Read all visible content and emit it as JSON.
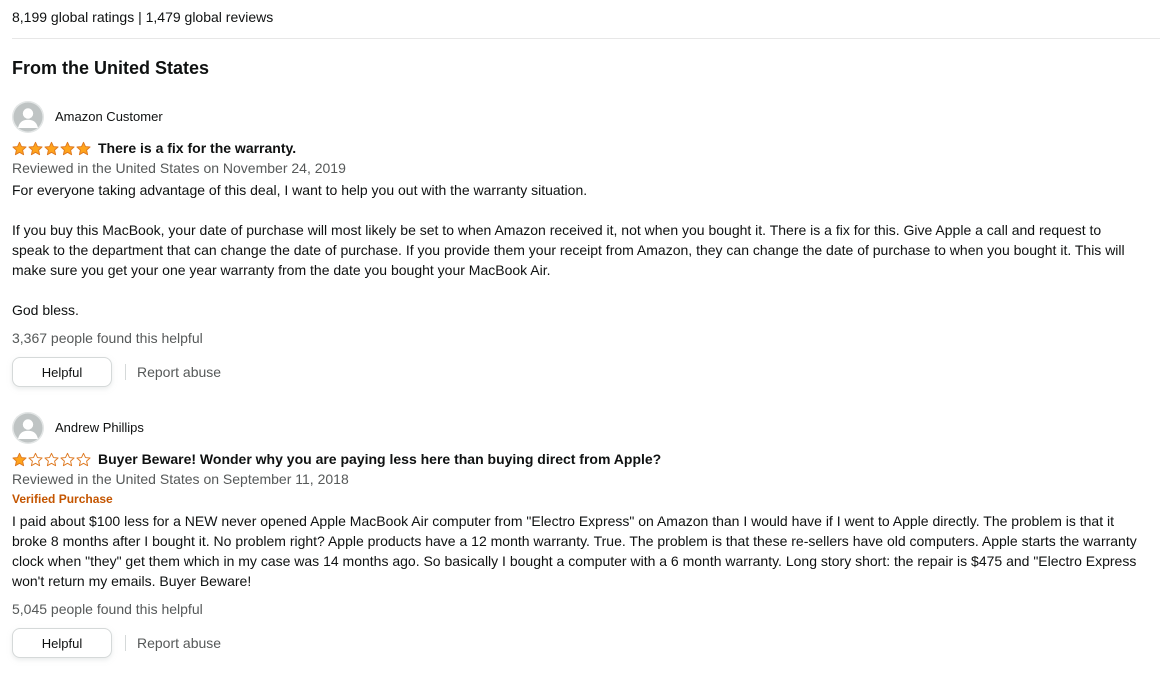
{
  "summary": {
    "ratings_text": "8,199 global ratings | 1,479 global reviews"
  },
  "section": {
    "title": "From the United States"
  },
  "colors": {
    "star_fill": "#ffa41c",
    "star_stroke": "#de7921",
    "verified": "#c45500",
    "muted": "#565959"
  },
  "reviews": [
    {
      "author": "Amazon Customer",
      "rating": 5,
      "rating_max": 5,
      "title": "There is a fix for the warranty.",
      "date": "Reviewed in the United States on November 24, 2019",
      "verified": "",
      "body": [
        "For everyone taking advantage of this deal, I want to help you out with the warranty situation.",
        "If you buy this MacBook, your date of purchase will most likely be set to when Amazon received it, not when you bought it. There is a fix for this. Give Apple a call and request to speak to the department that can change the date of purchase. If you provide them your receipt from Amazon, they can change the date of purchase to when you bought it. This will make sure you get your one year warranty from the date you bought your MacBook Air.",
        "God bless."
      ],
      "helpful_count": "3,367 people found this helpful",
      "helpful_label": "Helpful",
      "report_label": "Report abuse"
    },
    {
      "author": "Andrew Phillips",
      "rating": 1,
      "rating_max": 5,
      "title": "Buyer Beware! Wonder why you are paying less here than buying direct from Apple?",
      "date": "Reviewed in the United States on September 11, 2018",
      "verified": "Verified Purchase",
      "body": [
        "I paid about $100 less for a NEW never opened Apple MacBook Air computer from \"Electro Express\" on Amazon than I would have if I went to Apple directly. The problem is that it broke 8 months after I bought it. No problem right? Apple products have a 12 month warranty. True. The problem is that these re-sellers have old computers. Apple starts the warranty clock when \"they\" get them which in my case was 14 months ago. So basically I bought a computer with a 6 month warranty. Long story short: the repair is $475 and \"Electro Express won't return my emails. Buyer Beware!"
      ],
      "helpful_count": "5,045 people found this helpful",
      "helpful_label": "Helpful",
      "report_label": "Report abuse"
    }
  ]
}
